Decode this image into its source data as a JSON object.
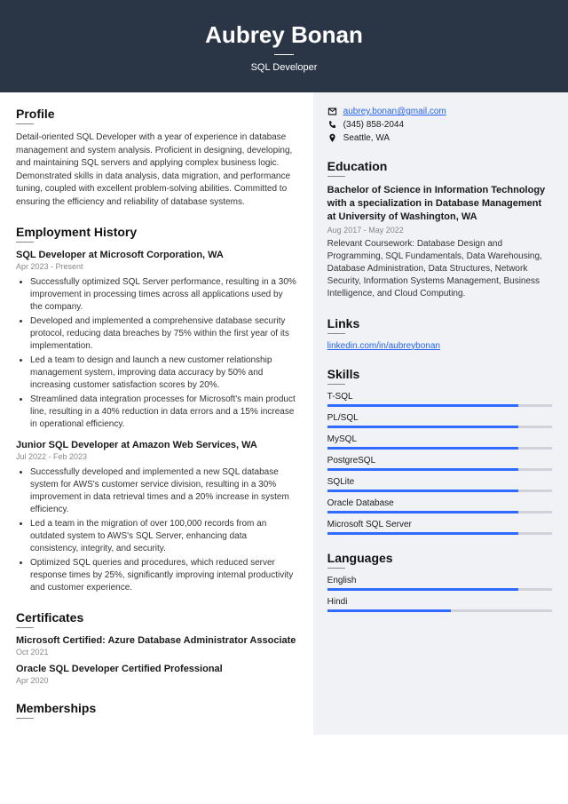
{
  "header": {
    "name": "Aubrey Bonan",
    "title": "SQL Developer"
  },
  "profile": {
    "heading": "Profile",
    "text": "Detail-oriented SQL Developer with a year of experience in database management and system analysis. Proficient in designing, developing, and maintaining SQL servers and applying complex business logic. Demonstrated skills in data analysis, data migration, and performance tuning, coupled with excellent problem-solving abilities. Committed to ensuring the efficiency and reliability of database systems."
  },
  "employment": {
    "heading": "Employment History",
    "jobs": [
      {
        "title": "SQL Developer at Microsoft Corporation, WA",
        "date": "Apr 2023 - Present",
        "bullets": [
          "Successfully optimized SQL Server performance, resulting in a 30% improvement in processing times across all applications used by the company.",
          "Developed and implemented a comprehensive database security protocol, reducing data breaches by 75% within the first year of its implementation.",
          "Led a team to design and launch a new customer relationship management system, improving data accuracy by 50% and increasing customer satisfaction scores by 20%.",
          "Streamlined data integration processes for Microsoft's main product line, resulting in a 40% reduction in data errors and a 15% increase in operational efficiency."
        ]
      },
      {
        "title": "Junior SQL Developer at Amazon Web Services, WA",
        "date": "Jul 2022 - Feb 2023",
        "bullets": [
          "Successfully developed and implemented a new SQL database system for AWS's customer service division, resulting in a 30% improvement in data retrieval times and a 20% increase in system efficiency.",
          "Led a team in the migration of over 100,000 records from an outdated system to AWS's SQL Server, enhancing data consistency, integrity, and security.",
          "Optimized SQL queries and procedures, which reduced server response times by 25%, significantly improving internal productivity and customer experience."
        ]
      }
    ]
  },
  "certificates": {
    "heading": "Certificates",
    "items": [
      {
        "title": "Microsoft Certified: Azure Database Administrator Associate",
        "date": "Oct 2021"
      },
      {
        "title": "Oracle SQL Developer Certified Professional",
        "date": "Apr 2020"
      }
    ]
  },
  "memberships": {
    "heading": "Memberships"
  },
  "contact": {
    "email": "aubrey.bonan@gmail.com",
    "phone": "(345) 858-2044",
    "location": "Seattle, WA"
  },
  "education": {
    "heading": "Education",
    "title": "Bachelor of Science in Information Technology with a specialization in Database Management at University of Washington, WA",
    "date": "Aug 2017 - May 2022",
    "desc": "Relevant Coursework: Database Design and Programming, SQL Fundamentals, Data Warehousing, Database Administration, Data Structures, Network Security, Information Systems Management, Business Intelligence, and Cloud Computing."
  },
  "links": {
    "heading": "Links",
    "url": "linkedin.com/in/aubreybonan"
  },
  "skills": {
    "heading": "Skills",
    "items": [
      {
        "name": "T-SQL",
        "pct": 85
      },
      {
        "name": "PL/SQL",
        "pct": 85
      },
      {
        "name": "MySQL",
        "pct": 85
      },
      {
        "name": "PostgreSQL",
        "pct": 85
      },
      {
        "name": "SQLite",
        "pct": 85
      },
      {
        "name": "Oracle Database",
        "pct": 85
      },
      {
        "name": "Microsoft SQL Server",
        "pct": 85
      }
    ]
  },
  "languages": {
    "heading": "Languages",
    "items": [
      {
        "name": "English",
        "pct": 85
      },
      {
        "name": "Hindi",
        "pct": 55
      }
    ]
  }
}
